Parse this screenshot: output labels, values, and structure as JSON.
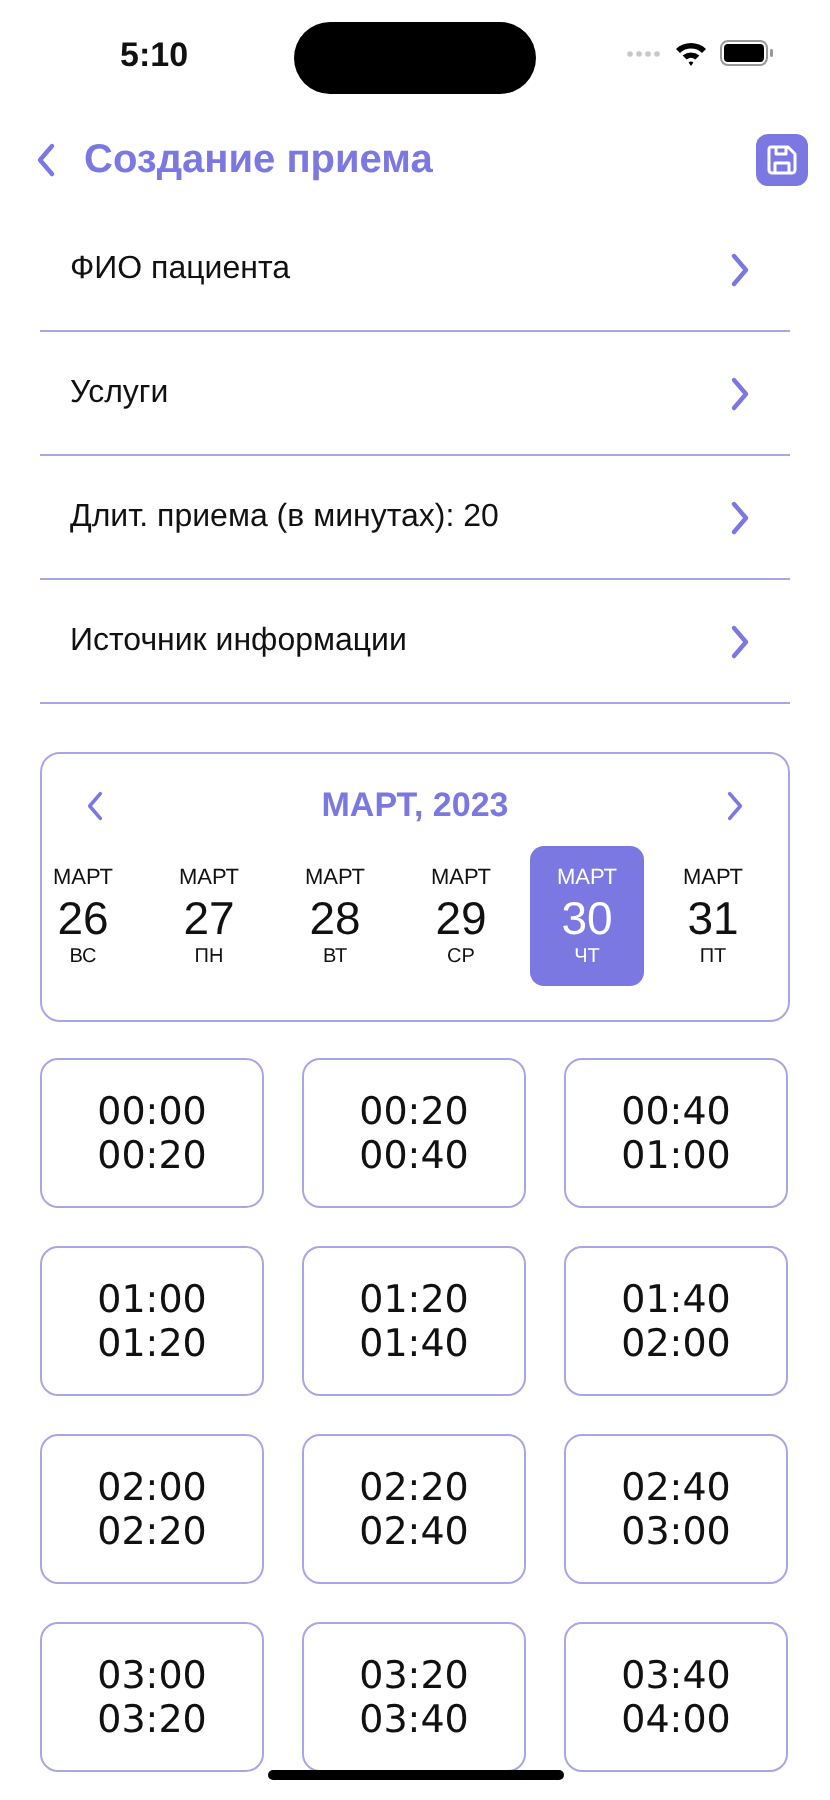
{
  "status_bar": {
    "time": "5:10"
  },
  "nav": {
    "title": "Создание приема"
  },
  "fields": [
    {
      "label": "ФИО пациента"
    },
    {
      "label": "Услуги"
    },
    {
      "label": "Длит. приема (в минутах): 20"
    },
    {
      "label": "Источник информации"
    }
  ],
  "calendar": {
    "title": "МАРТ, 2023",
    "days": [
      {
        "month": "МАРТ",
        "day": "26",
        "weekday": "ВС",
        "selected": false
      },
      {
        "month": "МАРТ",
        "day": "27",
        "weekday": "ПН",
        "selected": false
      },
      {
        "month": "МАРТ",
        "day": "28",
        "weekday": "ВТ",
        "selected": false
      },
      {
        "month": "МАРТ",
        "day": "29",
        "weekday": "СР",
        "selected": false
      },
      {
        "month": "МАРТ",
        "day": "30",
        "weekday": "ЧТ",
        "selected": true
      },
      {
        "month": "МАРТ",
        "day": "31",
        "weekday": "ПТ",
        "selected": false
      }
    ]
  },
  "slots": [
    {
      "start": "00:00",
      "end": "00:20",
      "selected": false
    },
    {
      "start": "00:20",
      "end": "00:40",
      "selected": false
    },
    {
      "start": "00:40",
      "end": "01:00",
      "selected": false
    },
    {
      "start": "01:00",
      "end": "01:20",
      "selected": false
    },
    {
      "start": "01:20",
      "end": "01:40",
      "selected": false
    },
    {
      "start": "01:40",
      "end": "02:00",
      "selected": false
    },
    {
      "start": "02:00",
      "end": "02:20",
      "selected": false
    },
    {
      "start": "02:20",
      "end": "02:40",
      "selected": false
    },
    {
      "start": "02:40",
      "end": "03:00",
      "selected": false
    },
    {
      "start": "03:00",
      "end": "03:20",
      "selected": false
    },
    {
      "start": "03:20",
      "end": "03:40",
      "selected": false
    },
    {
      "start": "03:40",
      "end": "04:00",
      "selected": false
    }
  ]
}
